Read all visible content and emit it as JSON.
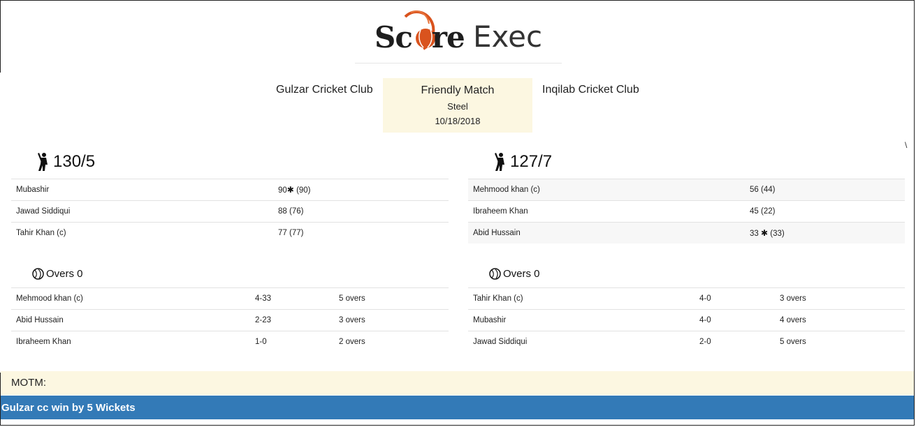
{
  "brand": {
    "logo_part1": "Sc",
    "logo_part2": "re",
    "logo_part3": "Exec"
  },
  "match": {
    "team_a": "Gulzar Cricket Club",
    "team_b": "Inqilab Cricket Club",
    "title": "Friendly Match",
    "venue": "Steel",
    "date": "10/18/2018"
  },
  "stray_char": "\\",
  "innings_a": {
    "score": "130/5",
    "batters": [
      {
        "name": "Mubashir",
        "runs": "90",
        "star": true,
        "balls": "(90)"
      },
      {
        "name": "Jawad Siddiqui",
        "runs": "88",
        "star": false,
        "balls": "(76)"
      },
      {
        "name": "Tahir Khan (c)",
        "runs": "77",
        "star": false,
        "balls": "(77)"
      }
    ],
    "overs_label": "Overs 0",
    "bowlers": [
      {
        "name": "Mehmood khan (c)",
        "figures": "4-33",
        "overs": "5 overs"
      },
      {
        "name": "Abid Hussain",
        "figures": "2-23",
        "overs": "3 overs"
      },
      {
        "name": "Ibraheem Khan",
        "figures": "1-0",
        "overs": "2 overs"
      }
    ]
  },
  "innings_b": {
    "score": "127/7",
    "batters": [
      {
        "name": "Mehmood khan (c)",
        "runs": "56",
        "star": false,
        "balls": "(44)"
      },
      {
        "name": "Ibraheem Khan",
        "runs": "45",
        "star": false,
        "balls": "(22)"
      },
      {
        "name": "Abid Hussain",
        "runs": "33",
        "star": true,
        "balls": "(33)"
      }
    ],
    "overs_label": "Overs 0",
    "bowlers": [
      {
        "name": "Tahir Khan (c)",
        "figures": "4-0",
        "overs": "3 overs"
      },
      {
        "name": "Mubashir",
        "figures": "4-0",
        "overs": "4 overs"
      },
      {
        "name": "Jawad Siddiqui",
        "figures": "2-0",
        "overs": "5 overs"
      }
    ]
  },
  "motm": {
    "label": "MOTM:"
  },
  "result": {
    "text": "Gulzar cc win by 5 Wickets"
  },
  "icons": {
    "batsman": "batsman-icon",
    "ball": "cricket-ball-icon",
    "star": "star-icon"
  },
  "colors": {
    "highlight": "#fcf7e1",
    "result_bar": "#337ab7",
    "logo_accent": "#d9531e"
  }
}
